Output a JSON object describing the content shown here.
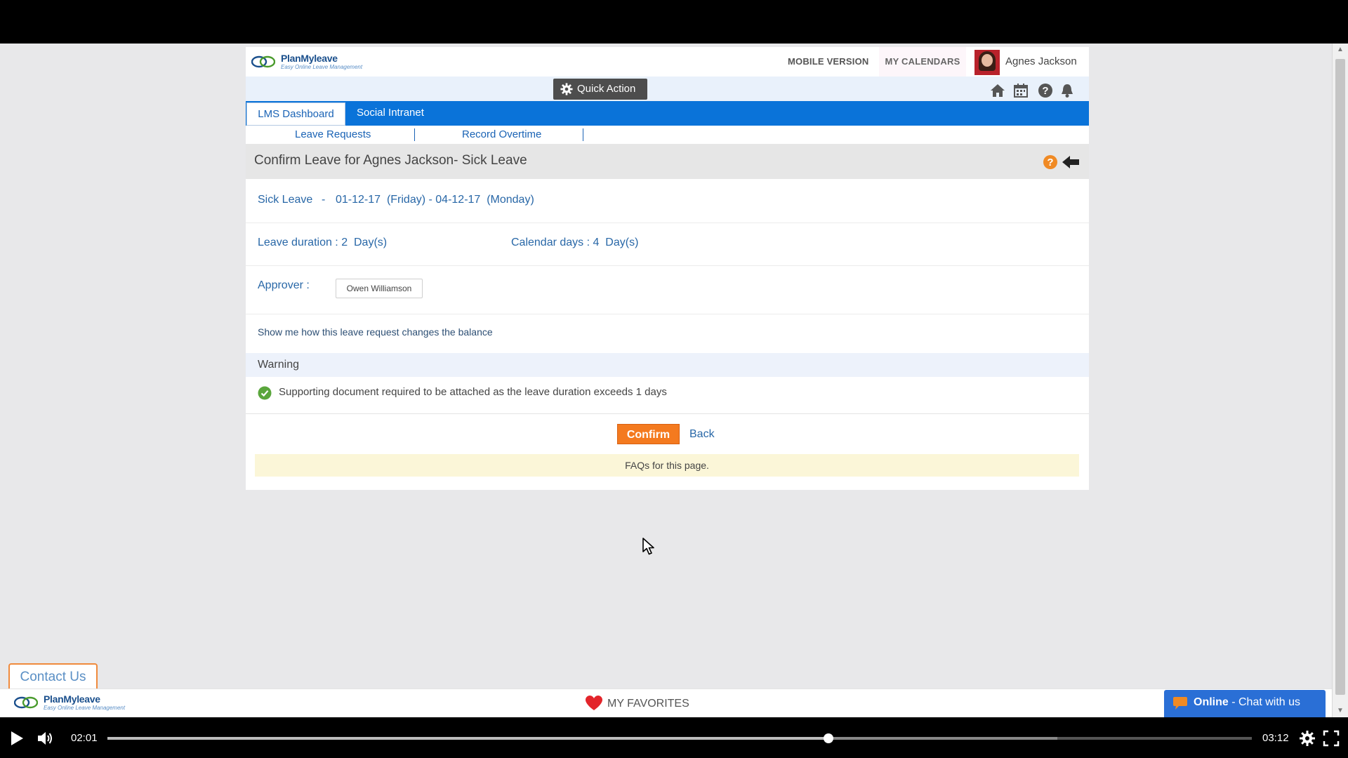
{
  "header": {
    "logo_main": "PlanMyleave",
    "logo_tag": "Easy Online Leave Management",
    "mobile_version": "MOBILE VERSION",
    "my_calendars": "MY CALENDARS",
    "user_name": "Agnes Jackson"
  },
  "toolbar": {
    "quick_action": "Quick Action",
    "icons": [
      "home-icon",
      "calendar-icon",
      "help-icon",
      "bell-icon"
    ]
  },
  "tabs": {
    "lms_dashboard": "LMS Dashboard",
    "social_intranet": "Social Intranet"
  },
  "subnav": {
    "leave_requests": "Leave Requests",
    "record_overtime": "Record Overtime",
    "separator": "|"
  },
  "page": {
    "title": "Confirm Leave for Agnes Jackson- Sick Leave",
    "leave_type": "Sick Leave",
    "date_range": "01-12-17  (Friday) - 04-12-17  (Monday)",
    "leave_duration": "Leave duration : 2  Day(s)",
    "calendar_days": "Calendar days : 4  Day(s)",
    "approver_label": "Approver :",
    "approver_name": "Owen Williamson",
    "balance_link": "Show me how this leave request changes the balance",
    "warning_title": "Warning",
    "warning_message": "Supporting document required to be attached as the leave duration exceeds 1 days",
    "confirm": "Confirm",
    "back": "Back",
    "faq": "FAQs for this page."
  },
  "footer": {
    "contact_us": "Contact Us",
    "my_favorites": "MY FAVORITES",
    "chat_status": "Online",
    "chat_text": " - Chat with us"
  },
  "player": {
    "current_time": "02:01",
    "total_time": "03:12",
    "progress_fraction": 0.63,
    "buffered_fraction": 0.83
  },
  "colors": {
    "nav_blue": "#0a73d9",
    "confirm_orange": "#f47a1f",
    "link_blue": "#2867a7",
    "chat_blue": "#2a6fd6"
  }
}
